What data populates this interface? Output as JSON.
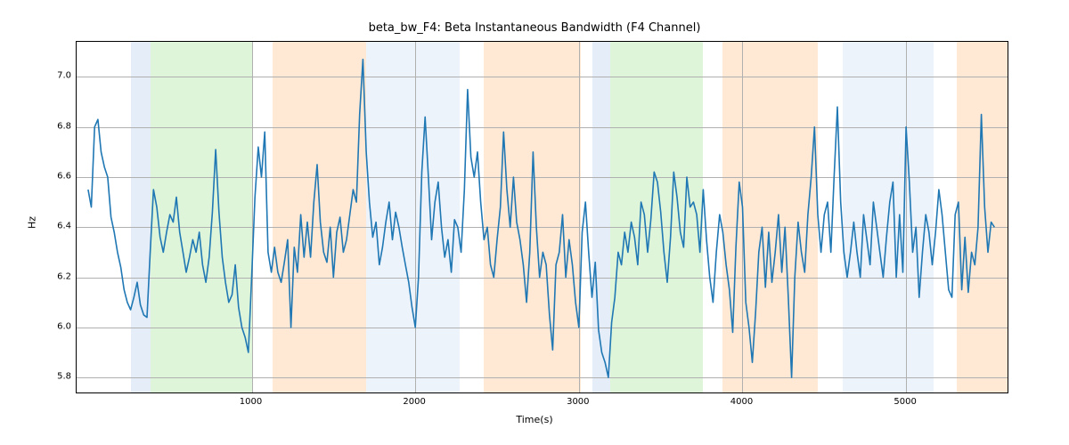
{
  "chart_data": {
    "type": "line",
    "title": "beta_bw_F4: Beta Instantaneous Bandwidth (F4 Channel)",
    "xlabel": "Time(s)",
    "ylabel": "Hz",
    "xlim": [
      -70,
      5620
    ],
    "ylim": [
      5.74,
      7.14
    ],
    "xticks": [
      1000,
      2000,
      3000,
      4000,
      5000
    ],
    "yticks": [
      5.8,
      6.0,
      6.2,
      6.4,
      6.6,
      6.8,
      7.0
    ],
    "bands": [
      {
        "x0": 260,
        "x1": 380,
        "color": "blue"
      },
      {
        "x0": 380,
        "x1": 1010,
        "color": "green"
      },
      {
        "x0": 1130,
        "x1": 1700,
        "color": "orange"
      },
      {
        "x0": 1700,
        "x1": 2270,
        "color": "lblue"
      },
      {
        "x0": 2420,
        "x1": 3010,
        "color": "orange"
      },
      {
        "x0": 3080,
        "x1": 3190,
        "color": "blue"
      },
      {
        "x0": 3190,
        "x1": 3760,
        "color": "green"
      },
      {
        "x0": 3880,
        "x1": 4460,
        "color": "orange"
      },
      {
        "x0": 4610,
        "x1": 5170,
        "color": "lblue"
      },
      {
        "x0": 5310,
        "x1": 5620,
        "color": "orange"
      }
    ],
    "x": [
      0,
      20,
      40,
      60,
      80,
      100,
      120,
      140,
      160,
      180,
      200,
      220,
      240,
      260,
      280,
      300,
      320,
      340,
      360,
      380,
      400,
      420,
      440,
      460,
      480,
      500,
      520,
      540,
      560,
      580,
      600,
      620,
      640,
      660,
      680,
      700,
      720,
      740,
      760,
      780,
      800,
      820,
      840,
      860,
      880,
      900,
      920,
      940,
      960,
      980,
      1000,
      1020,
      1040,
      1060,
      1080,
      1100,
      1120,
      1140,
      1160,
      1180,
      1200,
      1220,
      1240,
      1260,
      1280,
      1300,
      1320,
      1340,
      1360,
      1380,
      1400,
      1420,
      1440,
      1460,
      1480,
      1500,
      1520,
      1540,
      1560,
      1580,
      1600,
      1620,
      1640,
      1660,
      1680,
      1700,
      1720,
      1740,
      1760,
      1780,
      1800,
      1820,
      1840,
      1860,
      1880,
      1900,
      1920,
      1940,
      1960,
      1980,
      2000,
      2020,
      2040,
      2060,
      2080,
      2100,
      2120,
      2140,
      2160,
      2180,
      2200,
      2220,
      2240,
      2260,
      2280,
      2300,
      2320,
      2340,
      2360,
      2380,
      2400,
      2420,
      2440,
      2460,
      2480,
      2500,
      2520,
      2540,
      2560,
      2580,
      2600,
      2620,
      2640,
      2660,
      2680,
      2700,
      2720,
      2740,
      2760,
      2780,
      2800,
      2820,
      2840,
      2860,
      2880,
      2900,
      2920,
      2940,
      2960,
      2980,
      3000,
      3020,
      3040,
      3060,
      3080,
      3100,
      3120,
      3140,
      3160,
      3180,
      3200,
      3220,
      3240,
      3260,
      3280,
      3300,
      3320,
      3340,
      3360,
      3380,
      3400,
      3420,
      3440,
      3460,
      3480,
      3500,
      3520,
      3540,
      3560,
      3580,
      3600,
      3620,
      3640,
      3660,
      3680,
      3700,
      3720,
      3740,
      3760,
      3780,
      3800,
      3820,
      3840,
      3860,
      3880,
      3900,
      3920,
      3940,
      3960,
      3980,
      4000,
      4020,
      4040,
      4060,
      4080,
      4100,
      4120,
      4140,
      4160,
      4180,
      4200,
      4220,
      4240,
      4260,
      4280,
      4300,
      4320,
      4340,
      4360,
      4380,
      4400,
      4420,
      4440,
      4460,
      4480,
      4500,
      4520,
      4540,
      4560,
      4580,
      4600,
      4620,
      4640,
      4660,
      4680,
      4700,
      4720,
      4740,
      4760,
      4780,
      4800,
      4820,
      4840,
      4860,
      4880,
      4900,
      4920,
      4940,
      4960,
      4980,
      5000,
      5020,
      5040,
      5060,
      5080,
      5100,
      5120,
      5140,
      5160,
      5180,
      5200,
      5220,
      5240,
      5260,
      5280,
      5300,
      5320,
      5340,
      5360,
      5380,
      5400,
      5420,
      5440,
      5460,
      5480,
      5500,
      5520,
      5540
    ],
    "values": [
      6.55,
      6.48,
      6.8,
      6.83,
      6.7,
      6.64,
      6.6,
      6.44,
      6.38,
      6.3,
      6.24,
      6.15,
      6.1,
      6.07,
      6.12,
      6.18,
      6.09,
      6.05,
      6.04,
      6.3,
      6.55,
      6.48,
      6.36,
      6.3,
      6.38,
      6.45,
      6.42,
      6.52,
      6.38,
      6.3,
      6.22,
      6.28,
      6.35,
      6.3,
      6.38,
      6.25,
      6.18,
      6.28,
      6.46,
      6.71,
      6.46,
      6.28,
      6.18,
      6.1,
      6.13,
      6.25,
      6.08,
      6.0,
      5.96,
      5.9,
      6.2,
      6.52,
      6.72,
      6.6,
      6.78,
      6.3,
      6.22,
      6.32,
      6.22,
      6.18,
      6.26,
      6.35,
      6.0,
      6.32,
      6.22,
      6.45,
      6.28,
      6.42,
      6.28,
      6.5,
      6.65,
      6.42,
      6.3,
      6.26,
      6.4,
      6.2,
      6.38,
      6.44,
      6.3,
      6.35,
      6.45,
      6.55,
      6.5,
      6.85,
      7.07,
      6.7,
      6.5,
      6.36,
      6.42,
      6.25,
      6.32,
      6.42,
      6.5,
      6.35,
      6.46,
      6.4,
      6.32,
      6.25,
      6.18,
      6.08,
      6.0,
      6.2,
      6.62,
      6.84,
      6.6,
      6.35,
      6.5,
      6.58,
      6.4,
      6.28,
      6.35,
      6.22,
      6.43,
      6.4,
      6.3,
      6.55,
      6.95,
      6.68,
      6.6,
      6.7,
      6.5,
      6.35,
      6.4,
      6.25,
      6.2,
      6.35,
      6.48,
      6.78,
      6.55,
      6.4,
      6.6,
      6.42,
      6.35,
      6.25,
      6.1,
      6.3,
      6.7,
      6.4,
      6.2,
      6.3,
      6.25,
      6.05,
      5.91,
      6.25,
      6.3,
      6.45,
      6.2,
      6.35,
      6.25,
      6.1,
      6.0,
      6.38,
      6.5,
      6.3,
      6.12,
      6.26,
      5.99,
      5.9,
      5.86,
      5.8,
      6.02,
      6.12,
      6.3,
      6.25,
      6.38,
      6.3,
      6.42,
      6.36,
      6.25,
      6.5,
      6.45,
      6.3,
      6.43,
      6.62,
      6.58,
      6.46,
      6.3,
      6.18,
      6.36,
      6.62,
      6.52,
      6.38,
      6.32,
      6.6,
      6.48,
      6.5,
      6.45,
      6.3,
      6.55,
      6.35,
      6.2,
      6.1,
      6.3,
      6.45,
      6.38,
      6.25,
      6.15,
      5.98,
      6.32,
      6.58,
      6.48,
      6.1,
      6.0,
      5.86,
      6.06,
      6.3,
      6.4,
      6.16,
      6.38,
      6.18,
      6.3,
      6.45,
      6.22,
      6.4,
      6.12,
      5.8,
      6.2,
      6.42,
      6.3,
      6.22,
      6.45,
      6.6,
      6.8,
      6.45,
      6.3,
      6.45,
      6.5,
      6.3,
      6.6,
      6.88,
      6.5,
      6.3,
      6.2,
      6.3,
      6.42,
      6.3,
      6.2,
      6.45,
      6.35,
      6.25,
      6.5,
      6.4,
      6.3,
      6.2,
      6.36,
      6.5,
      6.58,
      6.2,
      6.45,
      6.22,
      6.8,
      6.58,
      6.3,
      6.4,
      6.12,
      6.3,
      6.45,
      6.38,
      6.25,
      6.38,
      6.55,
      6.45,
      6.3,
      6.15,
      6.12,
      6.45,
      6.5,
      6.15,
      6.36,
      6.14,
      6.3,
      6.25,
      6.4,
      6.85,
      6.48,
      6.3,
      6.42,
      6.4
    ]
  }
}
